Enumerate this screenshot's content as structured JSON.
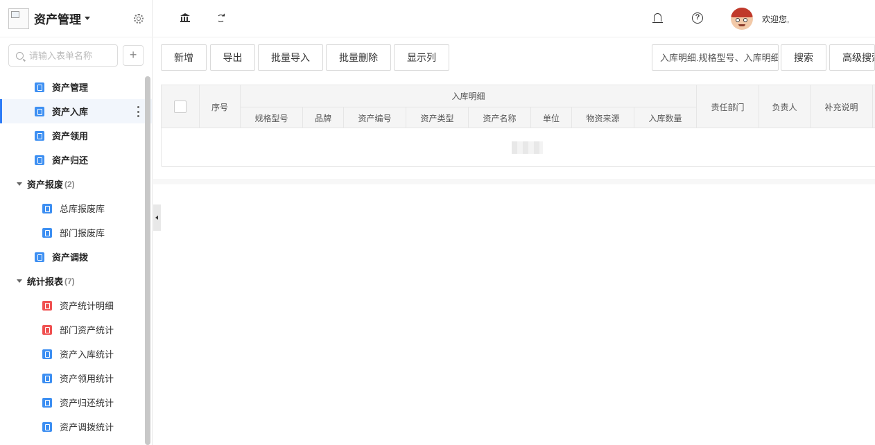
{
  "sidebar": {
    "app_title": "资产管理",
    "search_placeholder": "请输入表单名称",
    "plus_label": "+",
    "items": [
      {
        "label": "资产管理",
        "level": 1,
        "icon": "document-icon",
        "color": "#3d8ff2"
      },
      {
        "label": "资产入库",
        "level": 1,
        "icon": "document-icon",
        "color": "#3d8ff2",
        "active": true
      },
      {
        "label": "资产领用",
        "level": 1,
        "icon": "document-icon",
        "color": "#3d8ff2"
      },
      {
        "label": "资产归还",
        "level": 1,
        "icon": "document-icon",
        "color": "#3d8ff2"
      },
      {
        "label": "资产报废",
        "level": 0,
        "count": "(2)",
        "expanded": true
      },
      {
        "label": "总库报废库",
        "level": 2,
        "icon": "document-icon",
        "color": "#3d8ff2"
      },
      {
        "label": "部门报废库",
        "level": 2,
        "icon": "document-icon",
        "color": "#3d8ff2"
      },
      {
        "label": "资产调拨",
        "level": 1,
        "icon": "document-icon",
        "color": "#3d8ff2"
      },
      {
        "label": "统计报表",
        "level": 0,
        "count": "(7)",
        "expanded": true
      },
      {
        "label": "资产统计明细",
        "level": 2,
        "icon": "document-icon",
        "color": "#f05151"
      },
      {
        "label": "部门资产统计",
        "level": 2,
        "icon": "document-icon",
        "color": "#f05151"
      },
      {
        "label": "资产入库统计",
        "level": 2,
        "icon": "document-icon",
        "color": "#3d8ff2"
      },
      {
        "label": "资产领用统计",
        "level": 2,
        "icon": "document-icon",
        "color": "#3d8ff2"
      },
      {
        "label": "资产归还统计",
        "level": 2,
        "icon": "document-icon",
        "color": "#3d8ff2"
      },
      {
        "label": "资产调拨统计",
        "level": 2,
        "icon": "document-icon",
        "color": "#3d8ff2"
      }
    ]
  },
  "topbar": {
    "icons": [
      "bank-icon",
      "refresh-icon",
      "bell-icon",
      "help-icon"
    ],
    "help_glyph": "?",
    "welcome": "欢迎您,"
  },
  "toolbar": {
    "add": "新增",
    "export": "导出",
    "batch_import": "批量导入",
    "batch_delete": "批量删除",
    "show_columns": "显示列",
    "search_placeholder": "入库明细.规格型号、入库明细.",
    "search": "搜索",
    "advanced_search": "高级搜索"
  },
  "table": {
    "col_index": "序号",
    "group_header": "入库明细",
    "sub_columns": [
      "规格型号",
      "品牌",
      "资产编号",
      "资产类型",
      "资产名称",
      "单位",
      "物资来源",
      "入库数量"
    ],
    "col_dept": "责任部门",
    "col_owner": "负责人",
    "col_note": "补充说明"
  },
  "colors": {
    "accent": "#2e7cf6",
    "doc_blue": "#3d8ff2",
    "doc_red": "#f05151"
  }
}
